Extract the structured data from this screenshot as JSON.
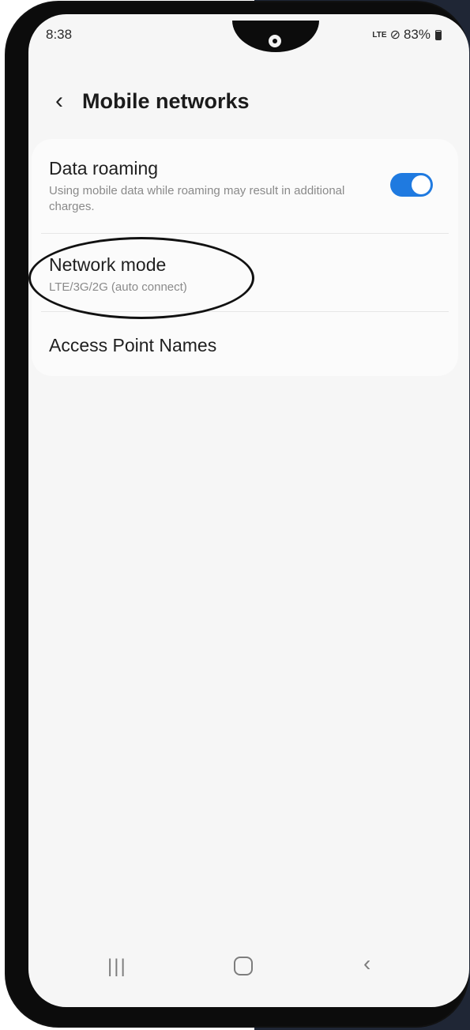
{
  "status_bar": {
    "time": "8:38",
    "network": "LTE",
    "battery_percent": "83%"
  },
  "header": {
    "title": "Mobile networks"
  },
  "settings": {
    "data_roaming": {
      "title": "Data roaming",
      "description": "Using mobile data while roaming may result in additional charges.",
      "enabled": true
    },
    "network_mode": {
      "title": "Network mode",
      "value": "LTE/3G/2G (auto connect)"
    },
    "apn": {
      "title": "Access Point Names"
    }
  },
  "colors": {
    "accent": "#1f7ae0",
    "annotation": "#111111"
  },
  "nav_icons": [
    "recents-icon",
    "home-icon",
    "back-icon"
  ]
}
